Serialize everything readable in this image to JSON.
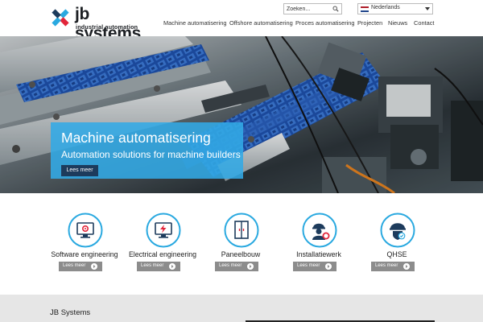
{
  "brand": {
    "name": "jb systems",
    "tagline": "industrial automation",
    "colors": {
      "accent": "#2aa9e0",
      "dark": "#1d3b5c",
      "red": "#e2253a"
    }
  },
  "header": {
    "search": {
      "placeholder": "Zoeken...",
      "icon": "search-icon"
    },
    "language": {
      "selected": "Nederlands",
      "icon": "dutch-flag-icon"
    },
    "nav": [
      {
        "label": "Machine automatisering"
      },
      {
        "label": "Offshore automatisering"
      },
      {
        "label": "Proces automatisering"
      },
      {
        "label": "Projecten"
      },
      {
        "label": "Nieuws"
      },
      {
        "label": "Contact"
      }
    ]
  },
  "hero": {
    "title": "Machine automatisering",
    "subtitle": "Automation solutions for machine builders",
    "button": "Lees meer"
  },
  "services": [
    {
      "title": "Software engineering",
      "button": "Lees meer",
      "icon": "monitor-gear-icon"
    },
    {
      "title": "Electrical engineering",
      "button": "Lees meer",
      "icon": "monitor-bolt-icon"
    },
    {
      "title": "Paneelbouw",
      "button": "Lees meer",
      "icon": "cabinet-icon"
    },
    {
      "title": "Installatiewerk",
      "button": "Lees meer",
      "icon": "worker-icon"
    },
    {
      "title": "QHSE",
      "button": "Lees meer",
      "icon": "safety-helmet-icon"
    }
  ],
  "footer": {
    "title": "JB Systems"
  }
}
